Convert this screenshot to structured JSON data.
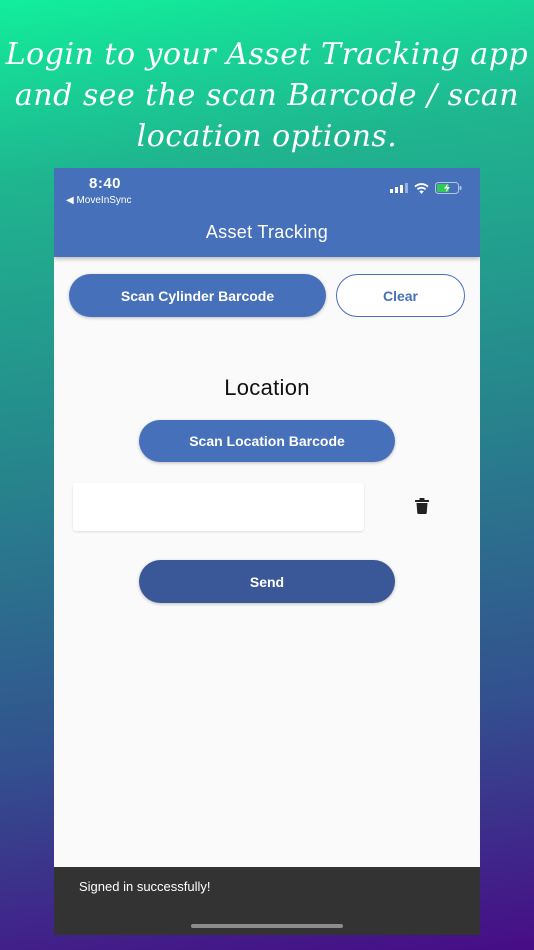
{
  "headline": {
    "line1": "Login to your Asset Tracking app",
    "line2": "and see the scan Barcode / scan",
    "line3": "location options."
  },
  "status_bar": {
    "time": "8:40",
    "back_app": "◀ MoveInSync",
    "icons": [
      "signal-icon",
      "wifi-icon",
      "battery-charging-icon"
    ]
  },
  "app_bar": {
    "title": "Asset Tracking"
  },
  "actions": {
    "scan_cylinder_label": "Scan Cylinder Barcode",
    "clear_label": "Clear"
  },
  "location": {
    "title": "Location",
    "scan_location_label": "Scan Location Barcode",
    "field_value": ""
  },
  "send_label": "Send",
  "snackbar": {
    "message": "Signed in successfully!"
  },
  "colors": {
    "primary": "#4670b9",
    "send_button": "#3a5898",
    "snackbar": "#333333",
    "battery": "#34c759"
  }
}
